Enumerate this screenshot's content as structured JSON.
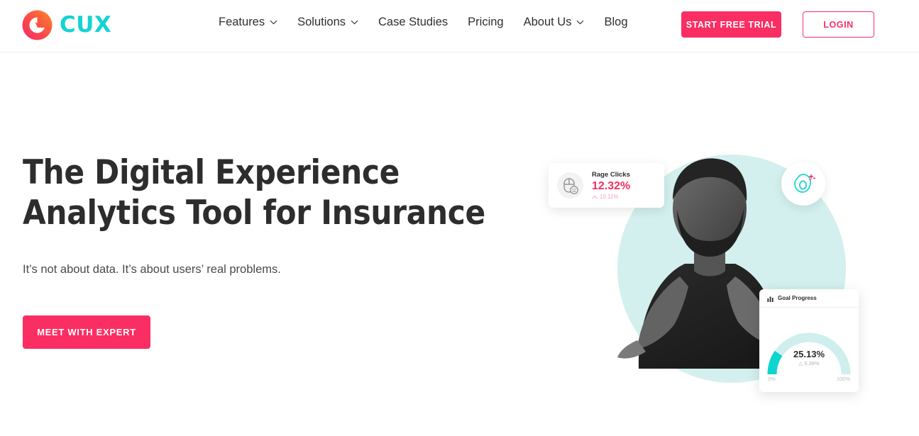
{
  "brand": {
    "name": "CUX",
    "logo_icon": "cux-logo-mark",
    "accent_pink": "#FA2E63",
    "accent_cyan": "#14D3D3",
    "backdrop_teal": "#D3F0EE"
  },
  "nav": {
    "items": [
      {
        "label": "Features",
        "has_dropdown": true
      },
      {
        "label": "Solutions",
        "has_dropdown": true
      },
      {
        "label": "Case Studies",
        "has_dropdown": false
      },
      {
        "label": "Pricing",
        "has_dropdown": false
      },
      {
        "label": "About Us",
        "has_dropdown": true
      },
      {
        "label": "Blog",
        "has_dropdown": false
      }
    ],
    "trial_button": "START FREE TRIAL",
    "login_button": "LOGIN"
  },
  "hero": {
    "title_line1": "The Digital Experience",
    "title_line2": "Analytics Tool for Insurance",
    "subtitle": "It’s not about data. It’s about users’ real problems.",
    "cta_button": "MEET WITH EXPERT"
  },
  "widgets": {
    "rage_clicks": {
      "icon": "angry-mouse-icon",
      "label": "Rage Clicks",
      "value": "12.32%",
      "delta": "10.11%",
      "delta_direction": "up"
    },
    "avocado_badge": {
      "icon": "avocado-icon",
      "sparkle_icon": "sparkles-icon"
    },
    "goal_progress": {
      "icon": "bar-chart-icon",
      "title": "Goal Progress",
      "value": "25.13%",
      "delta": "5.38%",
      "delta_direction": "up",
      "axis_min": "0%",
      "axis_max": "100%",
      "percent": 25.13
    }
  }
}
